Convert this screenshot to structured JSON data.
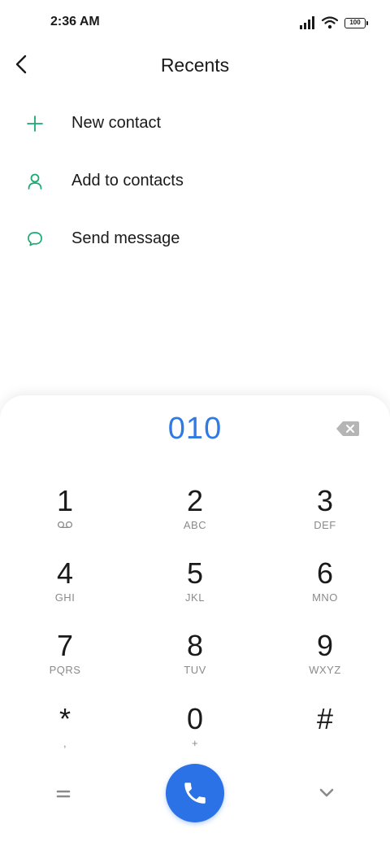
{
  "status_bar": {
    "time": "2:36 AM",
    "battery": "100"
  },
  "header": {
    "title": "Recents"
  },
  "menu": [
    {
      "label": "New contact",
      "icon": "plus-icon"
    },
    {
      "label": "Add to contacts",
      "icon": "person-icon"
    },
    {
      "label": "Send message",
      "icon": "message-icon"
    }
  ],
  "dialpad": {
    "number": "010",
    "keys": [
      {
        "digit": "1",
        "letters": ""
      },
      {
        "digit": "2",
        "letters": "ABC"
      },
      {
        "digit": "3",
        "letters": "DEF"
      },
      {
        "digit": "4",
        "letters": "GHI"
      },
      {
        "digit": "5",
        "letters": "JKL"
      },
      {
        "digit": "6",
        "letters": "MNO"
      },
      {
        "digit": "7",
        "letters": "PQRS"
      },
      {
        "digit": "8",
        "letters": "TUV"
      },
      {
        "digit": "9",
        "letters": "WXYZ"
      },
      {
        "digit": "*",
        "letters": ","
      },
      {
        "digit": "0",
        "letters": "+"
      },
      {
        "digit": "#",
        "letters": ""
      }
    ]
  },
  "colors": {
    "accent": "#2f7be5",
    "icon_green": "#1aaa74",
    "call_button": "#2a72e6"
  }
}
